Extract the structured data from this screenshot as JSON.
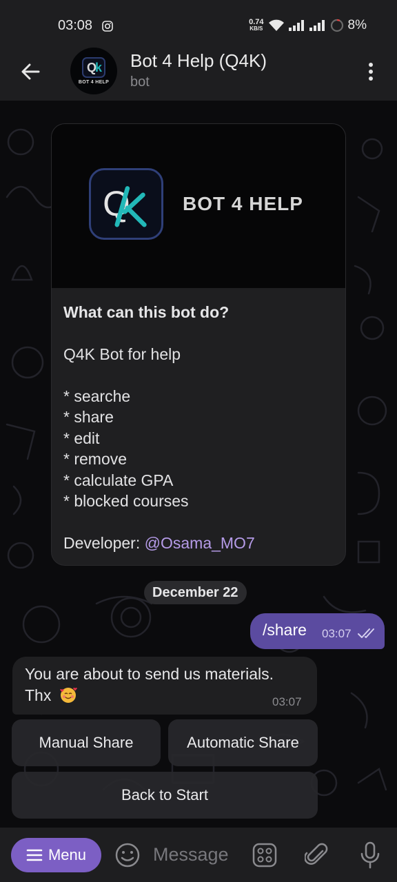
{
  "status_bar": {
    "time": "03:08",
    "net_speed_value": "0.74",
    "net_speed_unit": "KB/S",
    "battery": "8%"
  },
  "header": {
    "title": "Bot 4 Help (Q4K)",
    "subtitle": "bot",
    "avatar_text": "BOT 4 HELP"
  },
  "intro": {
    "image_wordmark": "BOT 4 HELP",
    "heading": "What can this bot do?",
    "line1": "Q4K Bot for help",
    "features": [
      "* searche",
      "* share",
      "* edit",
      "* remove",
      "* calculate GPA",
      "* blocked courses"
    ],
    "developer_label": "Developer: ",
    "developer_link": "@Osama_MO7"
  },
  "date_separator": "December 22",
  "outgoing": {
    "text": "/share",
    "time": "03:07"
  },
  "incoming": {
    "line1": "You are about to send us materials.",
    "line2": "Thx",
    "time": "03:07"
  },
  "keyboard": {
    "manual": "Manual Share",
    "automatic": "Automatic Share",
    "back": "Back to Start"
  },
  "input_bar": {
    "menu_label": "Menu",
    "placeholder": "Message"
  },
  "colors": {
    "accent": "#7c5fc4",
    "outgoing_bubble": "#5b4ba0",
    "link": "#b59be8"
  }
}
